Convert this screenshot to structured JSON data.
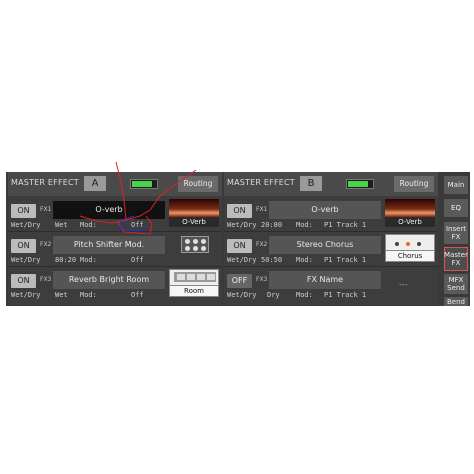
{
  "panel_a": {
    "title": "MASTER EFFECT",
    "letter": "A",
    "routing_label": "Routing",
    "meter_level": 0.85,
    "fx": [
      {
        "on_label": "ON",
        "slot": "FX1",
        "name": "O-verb",
        "wetdry_label": "Wet/Dry",
        "wetdry": "Wet",
        "mod_label": "Mod:",
        "mod": "Off",
        "thumb_label": "O-Verb"
      },
      {
        "on_label": "ON",
        "slot": "FX2",
        "name": "Pitch Shifter Mod.",
        "wetdry_label": "Wet/Dry",
        "wetdry": "80:20",
        "mod_label": "Mod:",
        "mod": "Off"
      },
      {
        "on_label": "ON",
        "slot": "FX3",
        "name": "Reverb Bright Room",
        "wetdry_label": "Wet/Dry",
        "wetdry": "Wet",
        "mod_label": "Mod:",
        "mod": "Off",
        "thumb_label": "Room"
      }
    ]
  },
  "panel_b": {
    "title": "MASTER EFFECT",
    "letter": "B",
    "routing_label": "Routing",
    "meter_level": 0.85,
    "fx": [
      {
        "on_label": "ON",
        "slot": "FX1",
        "name": "O-verb",
        "wetdry_label": "Wet/Dry",
        "wetdry": "20:80",
        "mod_label": "Mod:",
        "mod": "P1 Track 1",
        "thumb_label": "O-Verb"
      },
      {
        "on_label": "ON",
        "slot": "FX2",
        "name": "Stereo Chorus",
        "wetdry_label": "Wet/Dry",
        "wetdry": "50:50",
        "mod_label": "Mod:",
        "mod": "P1 Track 1",
        "thumb_label": "Chorus"
      },
      {
        "on_label": "OFF",
        "slot": "FX3",
        "name": "FX Name",
        "wetdry_label": "Wet/Dry",
        "wetdry": "Dry",
        "mod_label": "Mod:",
        "mod": "P1 Track 1",
        "empty_thumb": "---"
      }
    ]
  },
  "side_nav": {
    "items": [
      {
        "label": "Main"
      },
      {
        "label": "EQ"
      },
      {
        "label": "Insert FX"
      },
      {
        "label": "Master FX"
      },
      {
        "label": "MFX Send"
      },
      {
        "label": "Bend"
      }
    ],
    "active": "Master FX"
  },
  "colors": {
    "panel_bg": "#3d3d3d",
    "header_bg": "#4a4a4a",
    "meter_green": "#4bd24b",
    "annotation_red": "#e02020",
    "annotation_blue": "#2030d0",
    "active_border": "#e05050"
  }
}
